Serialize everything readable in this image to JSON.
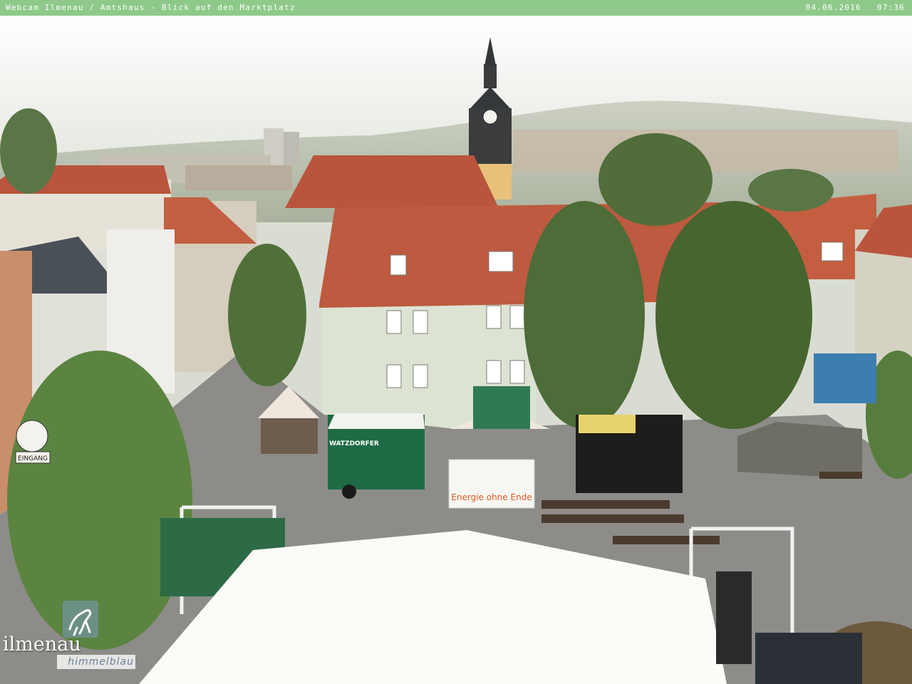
{
  "header": {
    "title": "Webcam Ilmenau / Amtshaus - Blick auf den Marktplatz",
    "date": "04.06.2016",
    "time": "07:36"
  },
  "scene": {
    "signs": {
      "eingang": "EINGANG",
      "trailer_brand": "WATZDORFER",
      "banner": "Energie ohne Ende"
    }
  },
  "logo": {
    "wordmark": "ilmenau",
    "tagline": "himmelblau"
  },
  "colors": {
    "header_bg": "#8ec98a",
    "header_text": "#ffffff",
    "sky": "#e4e7de",
    "roof": "#b9553d",
    "trailer": "#1f6b45"
  }
}
